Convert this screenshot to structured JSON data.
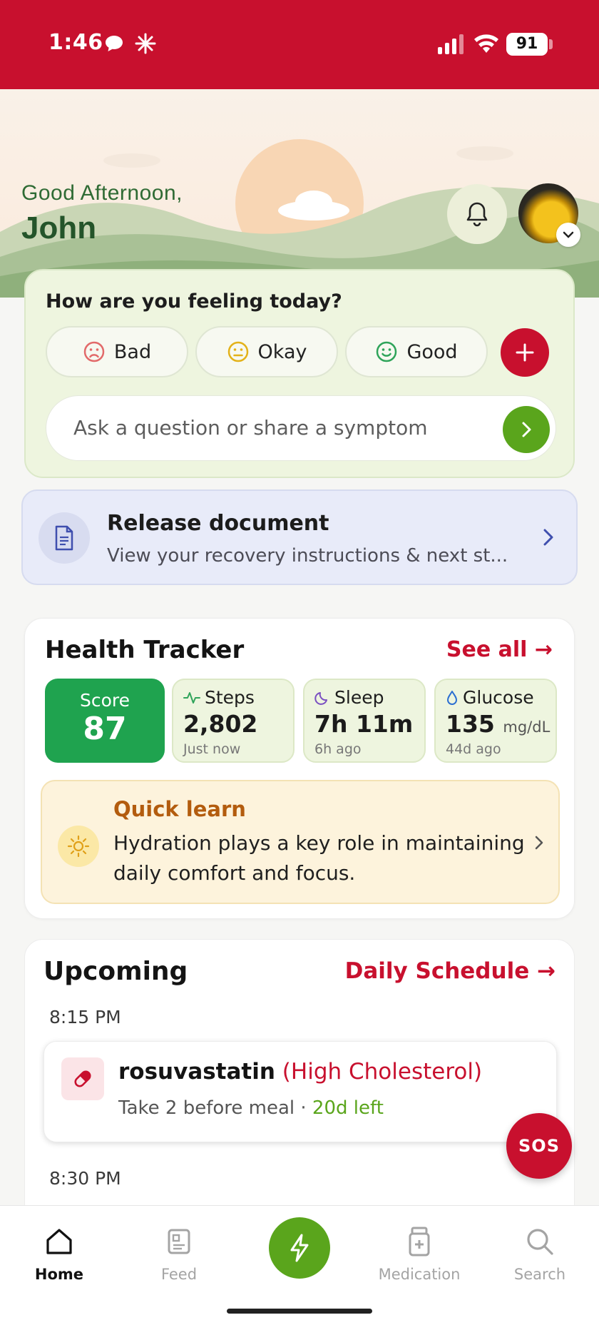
{
  "status_bar": {
    "time": "1:46",
    "battery": "91"
  },
  "header": {
    "greeting": "Good Afternoon,",
    "user_name": "John"
  },
  "feeling": {
    "title": "How are you feeling today?",
    "moods": [
      "Bad",
      "Okay",
      "Good"
    ],
    "ask_placeholder": "Ask a question or share a symptom"
  },
  "release": {
    "title": "Release document",
    "subtitle": "View your recovery instructions & next st..."
  },
  "tracker": {
    "title": "Health Tracker",
    "see_all": "See all →",
    "score_label": "Score",
    "score_value": "87",
    "metrics": [
      {
        "label": "Steps",
        "value": "2,802",
        "unit": "",
        "time": "Just now"
      },
      {
        "label": "Sleep",
        "value": "7h 11m",
        "unit": "",
        "time": "6h ago"
      },
      {
        "label": "Glucose",
        "value": "135",
        "unit": "mg/dL",
        "time": "44d ago"
      }
    ],
    "quick_learn_title": "Quick learn",
    "quick_learn_body": "Hydration plays a key role in maintaining daily comfort and focus."
  },
  "upcoming": {
    "title": "Upcoming",
    "schedule_link": "Daily Schedule →",
    "times": [
      "8:15 PM",
      "8:30 PM"
    ],
    "med_name": "rosuvastatin",
    "med_condition": "(High Cholesterol)",
    "med_instructions": "Take 2 before meal · ",
    "med_left": "20d left"
  },
  "sos": "SOS",
  "nav": {
    "items": [
      "Home",
      "Feed",
      "Medication",
      "Search"
    ]
  },
  "colors": {
    "brand_red": "#c8102e",
    "accent_green": "#5aa51c",
    "score_green": "#1fa34f"
  }
}
